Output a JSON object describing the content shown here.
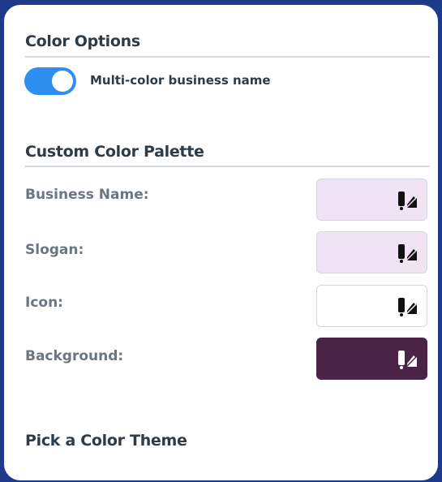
{
  "color_options": {
    "heading": "Color Options",
    "multicolor_toggle": {
      "label": "Multi-color business name",
      "enabled": true,
      "color": "#2e8ff0"
    }
  },
  "custom_palette": {
    "heading": "Custom Color Palette",
    "rows": [
      {
        "label": "Business Name:",
        "color": "#f0e4f4",
        "icon": "color-picker-icon"
      },
      {
        "label": "Slogan:",
        "color": "#f0e4f4",
        "icon": "color-picker-icon"
      },
      {
        "label": "Icon:",
        "color": "#ffffff",
        "icon": "color-picker-icon"
      },
      {
        "label": "Background:",
        "color": "#4a2347",
        "icon": "color-picker-icon"
      }
    ]
  },
  "theme_section": {
    "heading": "Pick a Color Theme"
  }
}
